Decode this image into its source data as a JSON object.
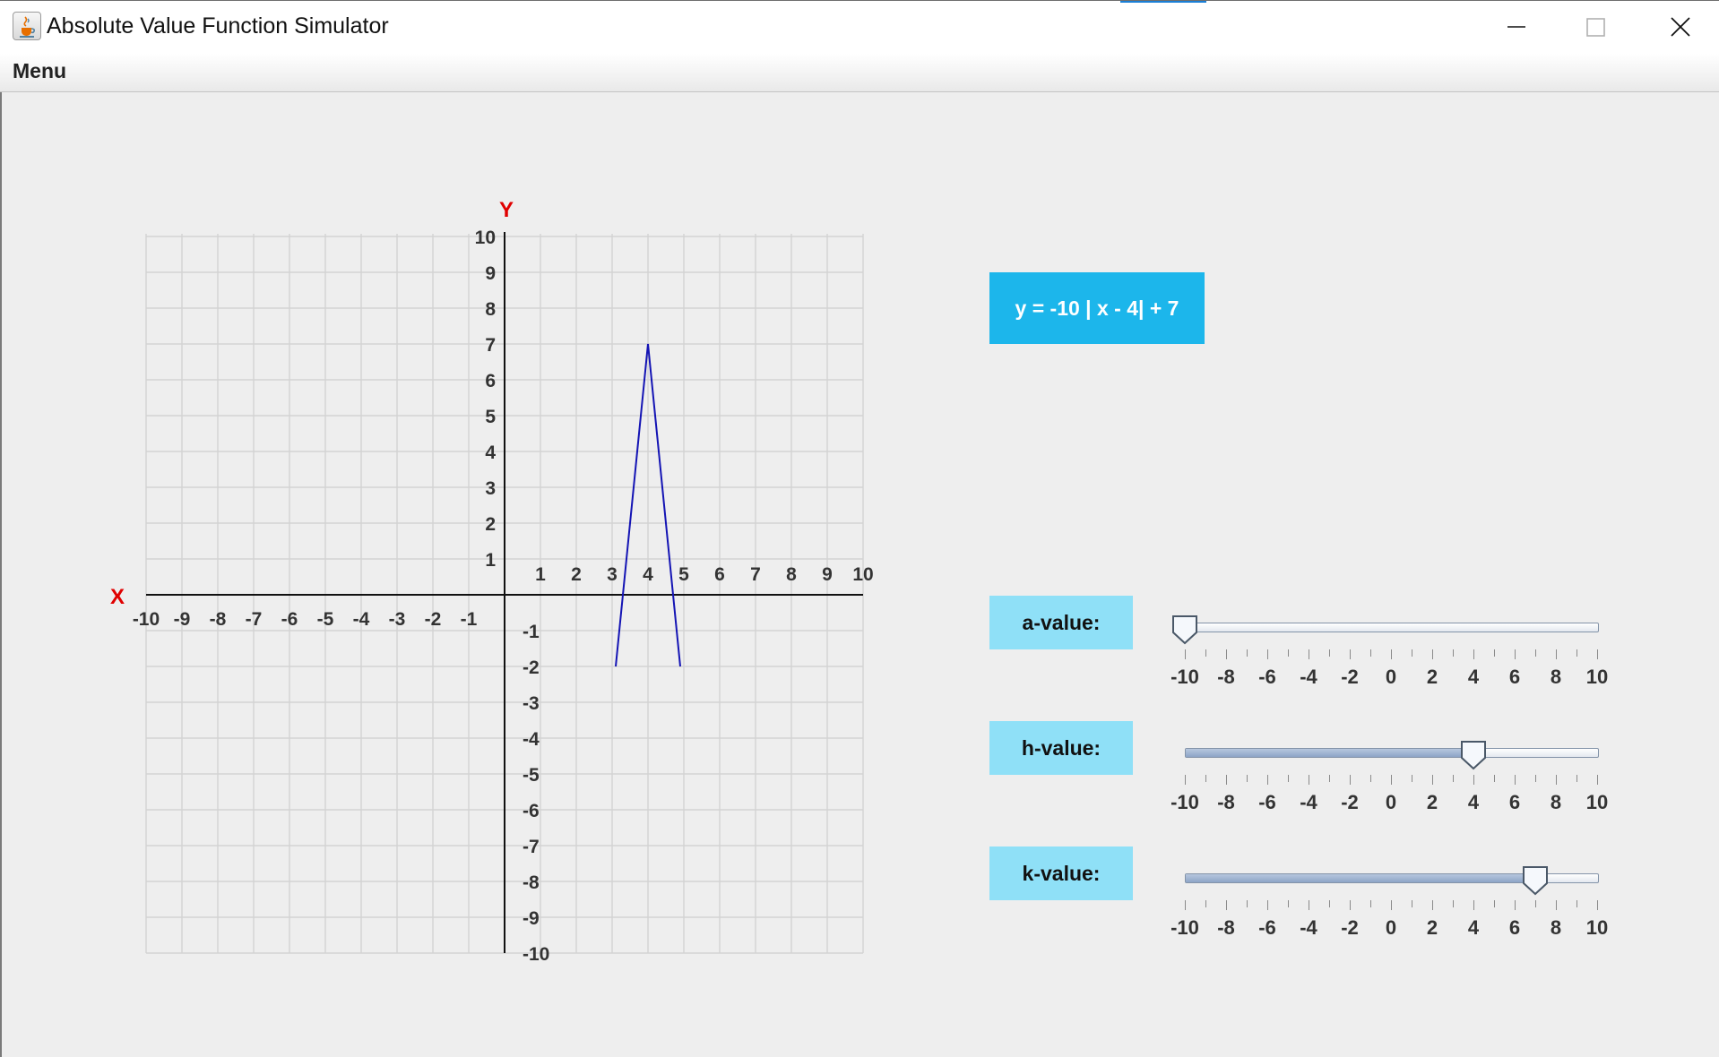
{
  "window": {
    "title": "Absolute Value Function Simulator",
    "app_icon": "java-cup-icon",
    "controls": [
      "minimize-icon",
      "maximize-icon",
      "close-icon"
    ]
  },
  "menubar": {
    "items": [
      "Menu"
    ]
  },
  "graph": {
    "x_axis_label": "X",
    "y_axis_label": "Y",
    "x_tick_labels": [
      "-10",
      "-9",
      "-8",
      "-7",
      "-6",
      "-5",
      "-4",
      "-3",
      "-2",
      "-1",
      "1",
      "2",
      "3",
      "4",
      "5",
      "6",
      "7",
      "8",
      "9",
      "10"
    ],
    "y_tick_labels": [
      "10",
      "9",
      "8",
      "7",
      "6",
      "5",
      "4",
      "3",
      "2",
      "1",
      "-1",
      "-2",
      "-3",
      "-4",
      "-5",
      "-6",
      "-7",
      "-8",
      "-9",
      "-10"
    ],
    "x_range": [
      -10,
      10
    ],
    "y_range": [
      -10,
      10
    ],
    "grid": true,
    "axis_label_color": "#e00000",
    "curve_color": "#1414b4",
    "curve_points": [
      [
        3.1,
        -2
      ],
      [
        4,
        7
      ],
      [
        4.9,
        -2
      ]
    ]
  },
  "equation": {
    "text": "y = -10 | x - 4| + 7"
  },
  "sliders": [
    {
      "label": "a-value:",
      "value": -10,
      "min": -10,
      "max": 10
    },
    {
      "label": "h-value:",
      "value": 4,
      "min": -10,
      "max": 10
    },
    {
      "label": "k-value:",
      "value": 7,
      "min": -10,
      "max": 10
    }
  ],
  "slider_tick_labels": [
    "-10",
    "-8",
    "-6",
    "-4",
    "-2",
    "0",
    "2",
    "4",
    "6",
    "8",
    "10"
  ],
  "colors": {
    "equation_bg": "#1cb6eb",
    "label_bg": "#8fe0f7",
    "background": "#eeeeee"
  }
}
